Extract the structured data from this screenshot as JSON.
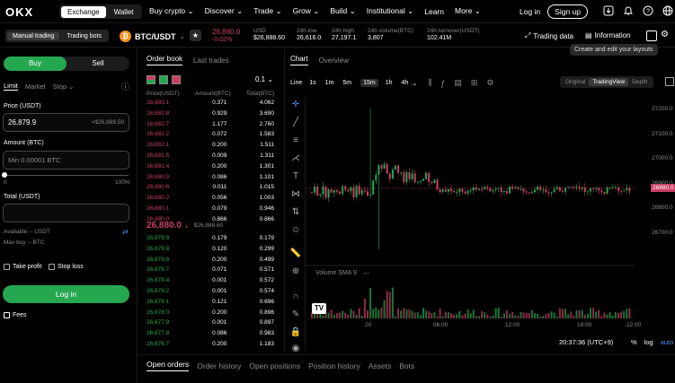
{
  "nav": {
    "logo": "OKX",
    "toggle": [
      "Exchange",
      "Wallet"
    ],
    "links": [
      "Buy crypto ⌄",
      "Discover ⌄",
      "Trade ⌄",
      "Grow ⌄",
      "Build ⌄",
      "Institutional ⌄",
      "Learn",
      "More ⌄"
    ],
    "login": "Log in",
    "signup": "Sign up"
  },
  "ticker": {
    "modes": [
      "Manual trading",
      "Trading bots"
    ],
    "coin_letter": "₿",
    "pair": "BTC/USDT",
    "price": "26,880.0",
    "change": "-0.02%",
    "usd_label": "USD",
    "usd_value": "$26,888.60",
    "stats": [
      {
        "label": "24h low",
        "value": "26,616.0"
      },
      {
        "label": "24h high",
        "value": "27,197.1"
      },
      {
        "label": "24h volume(BTC)",
        "value": "3,807"
      },
      {
        "label": "24h turnover(USDT)",
        "value": "102.41M"
      }
    ],
    "trading_data": "Trading data",
    "information": "Information",
    "tooltip": "Create and edit your layouts"
  },
  "order_form": {
    "buy": "Buy",
    "sell": "Sell",
    "types": [
      "Limit",
      "Market",
      "Stop ⌄"
    ],
    "price_label": "Price (USDT)",
    "price_value": "26,879.9",
    "price_usd": "≈$26,888.50",
    "amount_label": "Amount (BTC)",
    "amount_placeholder": "Min 0.00001 BTC",
    "slider_min": "0",
    "slider_max": "100%",
    "total_label": "Total (USDT)",
    "available": "Available -- USDT",
    "max_buy": "Max buy -- BTC",
    "take_profit": "Take profit",
    "stop_loss": "Stop loss",
    "login": "Log in",
    "fees": "Fees"
  },
  "orderbook": {
    "tabs": [
      "Order book",
      "Last trades"
    ],
    "precision": "0.1 ⌄",
    "headers": [
      "Price(USDT)",
      "Amount(BTC)",
      "Total(BTC)"
    ],
    "asks": [
      [
        "26,883.1",
        "0.371",
        "4.062"
      ],
      [
        "26,882.8",
        "0.929",
        "3.690"
      ],
      [
        "26,882.7",
        "1.177",
        "2.760"
      ],
      [
        "26,882.2",
        "0.072",
        "1.583"
      ],
      [
        "26,882.1",
        "0.200",
        "1.511"
      ],
      [
        "26,881.5",
        "0.009",
        "1.311"
      ],
      [
        "26,881.4",
        "0.200",
        "1.301"
      ],
      [
        "26,880.9",
        "0.086",
        "1.101"
      ],
      [
        "26,880.6",
        "0.011",
        "1.015"
      ],
      [
        "26,880.2",
        "0.056",
        "1.003"
      ],
      [
        "26,880.1",
        "0.079",
        "0.946"
      ],
      [
        "26,880.0",
        "0.866",
        "0.866"
      ]
    ],
    "mid_price": "26,880.0 ↓",
    "mid_usd": "$26,888.60",
    "bids": [
      [
        "26,879.9",
        "0.179",
        "0.179"
      ],
      [
        "26,879.8",
        "0.120",
        "0.299"
      ],
      [
        "26,878.8",
        "0.200",
        "0.499"
      ],
      [
        "26,878.7",
        "0.071",
        "0.571"
      ],
      [
        "26,878.4",
        "0.001",
        "0.572"
      ],
      [
        "26,878.2",
        "0.001",
        "0.574"
      ],
      [
        "26,878.1",
        "0.121",
        "0.696"
      ],
      [
        "26,878.0",
        "0.200",
        "0.896"
      ],
      [
        "26,877.9",
        "0.001",
        "0.897"
      ],
      [
        "26,877.8",
        "0.086",
        "0.983"
      ],
      [
        "26,876.7",
        "0.200",
        "1.183"
      ]
    ]
  },
  "chart": {
    "tabs": [
      "Chart",
      "Overview"
    ],
    "intervals": [
      "Line",
      "1s",
      "1m",
      "5m",
      "15m",
      "1h",
      "4h",
      "⌄"
    ],
    "views": [
      "Original",
      "TradingView",
      "Depth"
    ],
    "y_ticks": [
      "27200.0",
      "27100.0",
      "27000.0",
      "26900.0",
      "26800.0",
      "26700.0"
    ],
    "current_price": "26880.0",
    "volume_label": "Volume  SMA 9",
    "x_ticks": [
      "20",
      "06:00",
      "12:00",
      "18:00",
      "22:00"
    ],
    "clock": "20:37:36 (UTC+9)",
    "scale_opts": [
      "%",
      "log",
      "auto"
    ],
    "up_color": "#25a750",
    "down_color": "#ca3f64"
  },
  "bottom_tabs": [
    "Open orders",
    "Order history",
    "Open positions",
    "Position history",
    "Assets",
    "Bots"
  ]
}
